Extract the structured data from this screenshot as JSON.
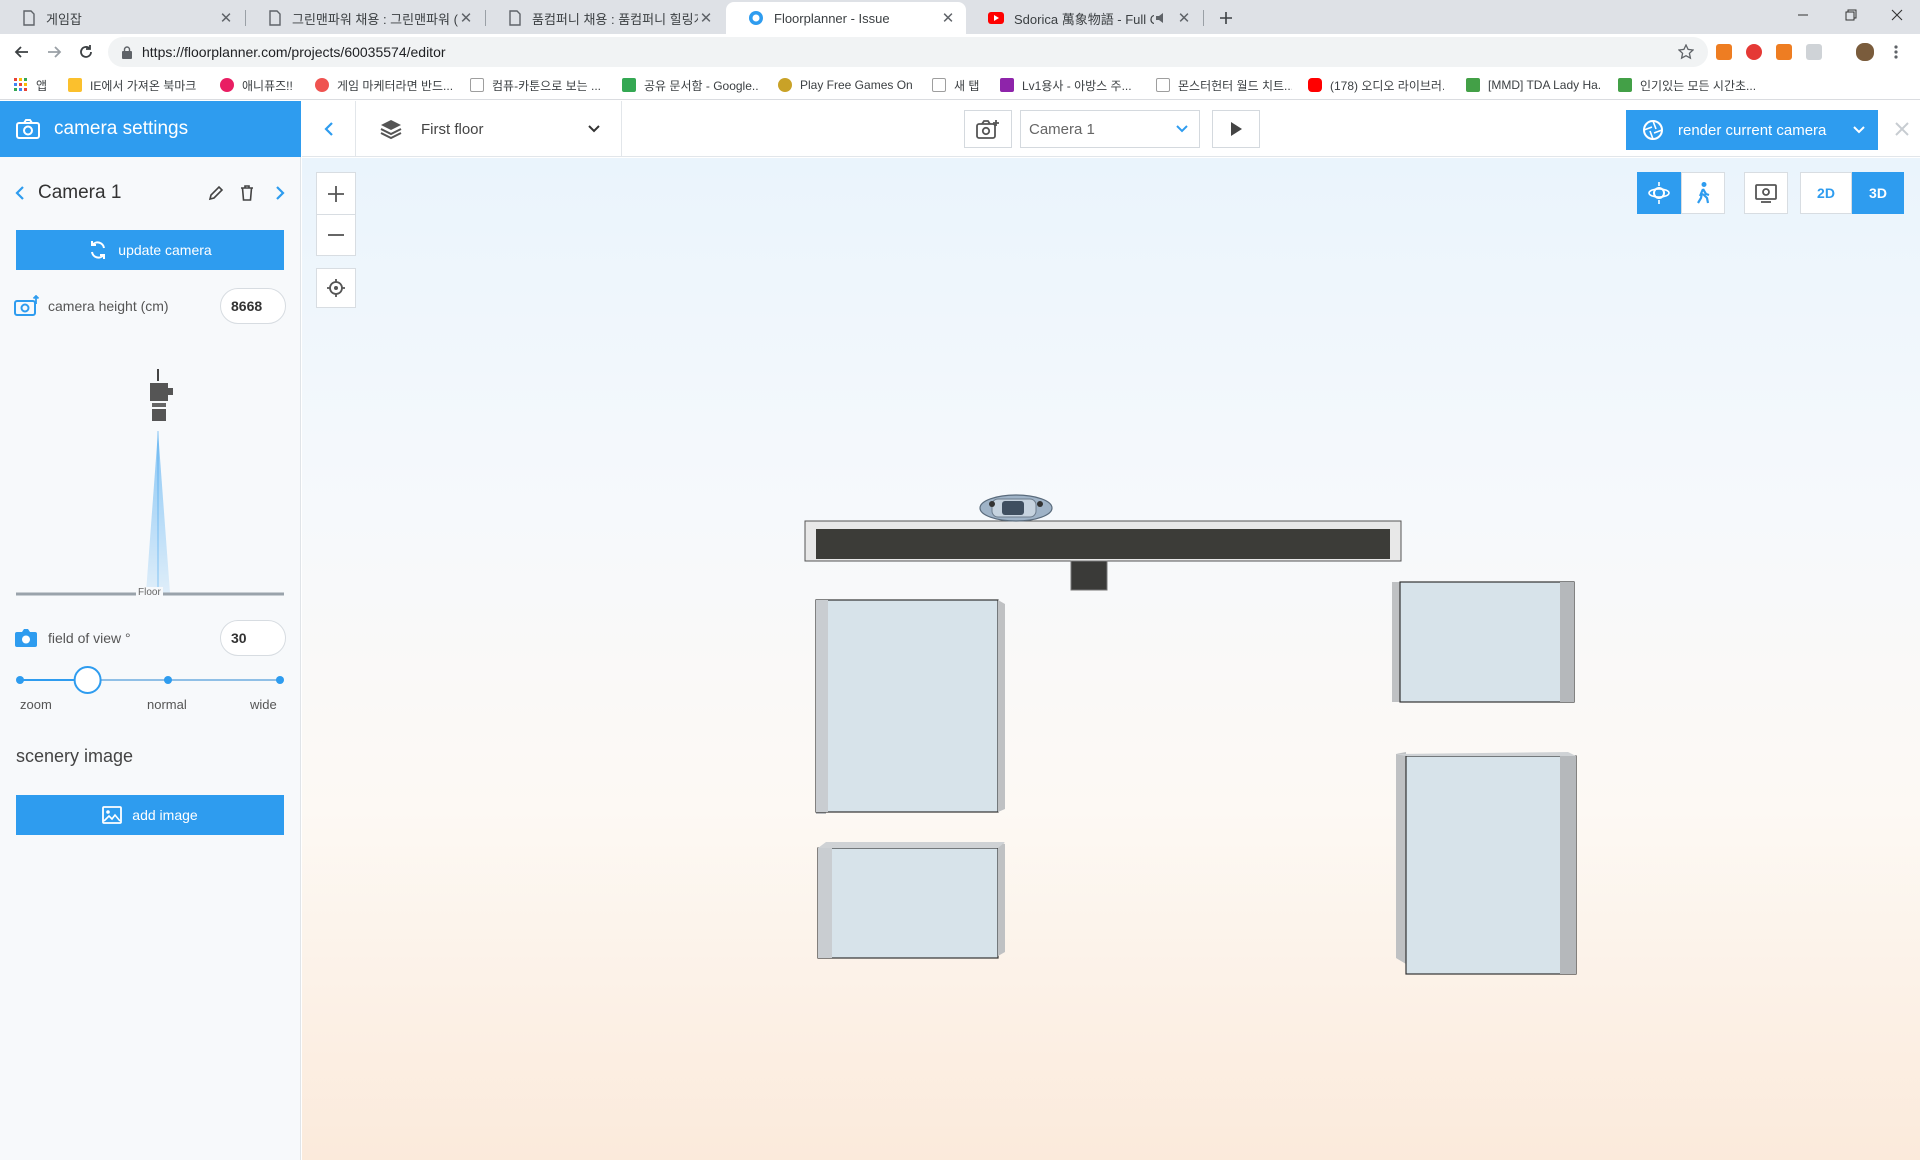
{
  "browser": {
    "tabs": [
      {
        "title": "게임잡"
      },
      {
        "title": "그린맨파워 채용 : 그린맨파워 (..."
      },
      {
        "title": "품컴퍼니 채용 : 품컴퍼니 힐링게..."
      },
      {
        "title": "Floorplanner - Issue"
      },
      {
        "title": "Sdorica 萬象物語 - Full OST"
      }
    ],
    "url": "https://floorplanner.com/projects/60035574/editor",
    "bookmarks": [
      {
        "label": "앱",
        "color": "#ea4335"
      },
      {
        "label": "IE에서 가져온 북마크",
        "color": "#fbc02d"
      },
      {
        "label": "애니퓨즈!!",
        "color": "#e91e63"
      },
      {
        "label": "게임 마케터라면 반드...",
        "color": "#ef5350"
      },
      {
        "label": "컴퓨-카툰으로 보는 ...",
        "color": "#9e9e9e"
      },
      {
        "label": "공유 문서함 - Google...",
        "color": "#34a853"
      },
      {
        "label": "Play Free Games On...",
        "color": "#c9a227"
      },
      {
        "label": "새 탭",
        "color": "#9e9e9e"
      },
      {
        "label": "Lv1용사 - 아방스 주...",
        "color": "#8e24aa"
      },
      {
        "label": "몬스터헌터 월드 치트...",
        "color": "#9e9e9e"
      },
      {
        "label": "(178) 오디오 라이브러...",
        "color": "#ff0000"
      },
      {
        "label": "[MMD] TDA Lady Ha...",
        "color": "#43a047"
      },
      {
        "label": "인기있는 모든 시간초...",
        "color": "#43a047"
      }
    ]
  },
  "sidebar": {
    "header_title": "camera settings",
    "camera_name": "Camera 1",
    "update_button": "update camera",
    "camera_height_label": "camera height (cm)",
    "camera_height_value": "8668",
    "floor_label": "Floor",
    "fov_label": "field of view °",
    "fov_value": "30",
    "fov_labels": {
      "zoom": "zoom",
      "normal": "normal",
      "wide": "wide"
    },
    "fov_level": 0.26,
    "scenery_title": "scenery image",
    "add_image_button": "add image"
  },
  "toolbar": {
    "floor_name": "First floor",
    "camera_select": "Camera 1",
    "render_button": "render current camera",
    "view_2d": "2D",
    "view_3d": "3D"
  },
  "colors": {
    "accent": "#2e9cef",
    "panel_bg": "#f7f9fb"
  }
}
